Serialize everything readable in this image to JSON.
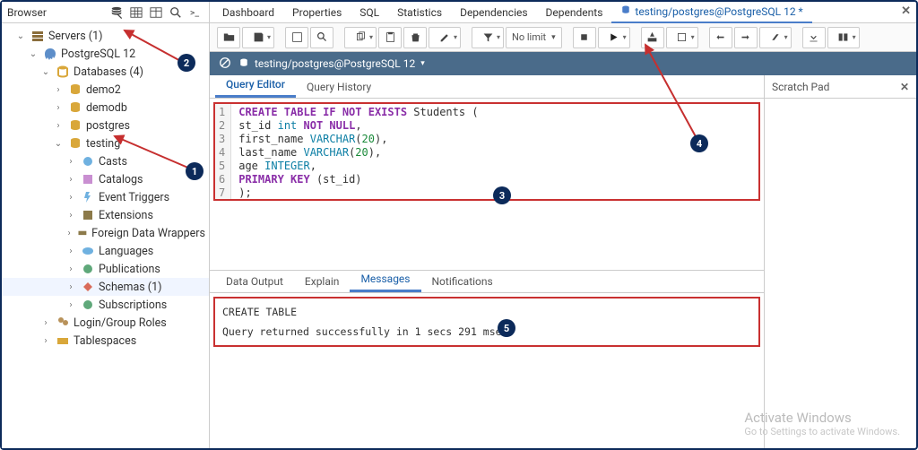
{
  "browser": {
    "title": "Browser",
    "tree": {
      "servers": "Servers (1)",
      "pg": "PostgreSQL 12",
      "databases": "Databases (4)",
      "db1": "demo2",
      "db2": "demodb",
      "db3": "postgres",
      "db4": "testing",
      "casts": "Casts",
      "catalogs": "Catalogs",
      "event_triggers": "Event Triggers",
      "extensions": "Extensions",
      "fdw": "Foreign Data Wrappers",
      "languages": "Languages",
      "publications": "Publications",
      "schemas": "Schemas (1)",
      "subscriptions": "Subscriptions",
      "login_roles": "Login/Group Roles",
      "tablespaces": "Tablespaces"
    }
  },
  "tabs": {
    "dashboard": "Dashboard",
    "properties": "Properties",
    "sql": "SQL",
    "statistics": "Statistics",
    "dependencies": "Dependencies",
    "dependents": "Dependents",
    "query": "testing/postgres@PostgreSQL 12 *"
  },
  "toolbar": {
    "nolimit": "No limit"
  },
  "connection": {
    "label": "testing/postgres@PostgreSQL 12"
  },
  "editor_tabs": {
    "query_editor": "Query Editor",
    "query_history": "Query History"
  },
  "scratch": {
    "title": "Scratch Pad"
  },
  "output_tabs": {
    "data_output": "Data Output",
    "explain": "Explain",
    "messages": "Messages",
    "notifications": "Notifications"
  },
  "output": {
    "line1": "CREATE TABLE",
    "line2": "Query returned successfully in 1 secs 291 msec."
  },
  "gutter": [
    "1",
    "2",
    "3",
    "4",
    "5",
    "6",
    "7"
  ],
  "sql": {
    "l1a": "CREATE TABLE IF NOT EXISTS",
    "l1b": " Students (",
    "l2a": "st_id ",
    "l2b": "int",
    "l2c": " NOT NULL",
    "l2d": ",",
    "l3a": "first_name ",
    "l3b": "VARCHAR",
    "l3c": "(",
    "l3d": "20",
    "l3e": "),",
    "l4a": "last_name ",
    "l4b": "VARCHAR",
    "l4c": "(",
    "l4d": "20",
    "l4e": "),",
    "l5a": "age ",
    "l5b": "INTEGER",
    "l5c": ",",
    "l6a": "PRIMARY KEY",
    "l6b": " (st_id)",
    "l7": ");"
  },
  "annotations": {
    "a1": "1",
    "a2": "2",
    "a3": "3",
    "a4": "4",
    "a5": "5"
  },
  "watermark": {
    "title": "Activate Windows",
    "sub": "Go to Settings to activate Windows."
  }
}
